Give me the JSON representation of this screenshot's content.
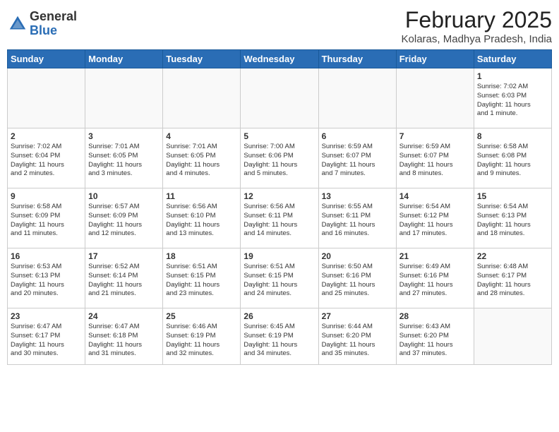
{
  "header": {
    "logo_general": "General",
    "logo_blue": "Blue",
    "month_title": "February 2025",
    "location": "Kolaras, Madhya Pradesh, India"
  },
  "weekdays": [
    "Sunday",
    "Monday",
    "Tuesday",
    "Wednesday",
    "Thursday",
    "Friday",
    "Saturday"
  ],
  "weeks": [
    [
      {
        "day": "",
        "info": ""
      },
      {
        "day": "",
        "info": ""
      },
      {
        "day": "",
        "info": ""
      },
      {
        "day": "",
        "info": ""
      },
      {
        "day": "",
        "info": ""
      },
      {
        "day": "",
        "info": ""
      },
      {
        "day": "1",
        "info": "Sunrise: 7:02 AM\nSunset: 6:03 PM\nDaylight: 11 hours\nand 1 minute."
      }
    ],
    [
      {
        "day": "2",
        "info": "Sunrise: 7:02 AM\nSunset: 6:04 PM\nDaylight: 11 hours\nand 2 minutes."
      },
      {
        "day": "3",
        "info": "Sunrise: 7:01 AM\nSunset: 6:05 PM\nDaylight: 11 hours\nand 3 minutes."
      },
      {
        "day": "4",
        "info": "Sunrise: 7:01 AM\nSunset: 6:05 PM\nDaylight: 11 hours\nand 4 minutes."
      },
      {
        "day": "5",
        "info": "Sunrise: 7:00 AM\nSunset: 6:06 PM\nDaylight: 11 hours\nand 5 minutes."
      },
      {
        "day": "6",
        "info": "Sunrise: 6:59 AM\nSunset: 6:07 PM\nDaylight: 11 hours\nand 7 minutes."
      },
      {
        "day": "7",
        "info": "Sunrise: 6:59 AM\nSunset: 6:07 PM\nDaylight: 11 hours\nand 8 minutes."
      },
      {
        "day": "8",
        "info": "Sunrise: 6:58 AM\nSunset: 6:08 PM\nDaylight: 11 hours\nand 9 minutes."
      }
    ],
    [
      {
        "day": "9",
        "info": "Sunrise: 6:58 AM\nSunset: 6:09 PM\nDaylight: 11 hours\nand 11 minutes."
      },
      {
        "day": "10",
        "info": "Sunrise: 6:57 AM\nSunset: 6:09 PM\nDaylight: 11 hours\nand 12 minutes."
      },
      {
        "day": "11",
        "info": "Sunrise: 6:56 AM\nSunset: 6:10 PM\nDaylight: 11 hours\nand 13 minutes."
      },
      {
        "day": "12",
        "info": "Sunrise: 6:56 AM\nSunset: 6:11 PM\nDaylight: 11 hours\nand 14 minutes."
      },
      {
        "day": "13",
        "info": "Sunrise: 6:55 AM\nSunset: 6:11 PM\nDaylight: 11 hours\nand 16 minutes."
      },
      {
        "day": "14",
        "info": "Sunrise: 6:54 AM\nSunset: 6:12 PM\nDaylight: 11 hours\nand 17 minutes."
      },
      {
        "day": "15",
        "info": "Sunrise: 6:54 AM\nSunset: 6:13 PM\nDaylight: 11 hours\nand 18 minutes."
      }
    ],
    [
      {
        "day": "16",
        "info": "Sunrise: 6:53 AM\nSunset: 6:13 PM\nDaylight: 11 hours\nand 20 minutes."
      },
      {
        "day": "17",
        "info": "Sunrise: 6:52 AM\nSunset: 6:14 PM\nDaylight: 11 hours\nand 21 minutes."
      },
      {
        "day": "18",
        "info": "Sunrise: 6:51 AM\nSunset: 6:15 PM\nDaylight: 11 hours\nand 23 minutes."
      },
      {
        "day": "19",
        "info": "Sunrise: 6:51 AM\nSunset: 6:15 PM\nDaylight: 11 hours\nand 24 minutes."
      },
      {
        "day": "20",
        "info": "Sunrise: 6:50 AM\nSunset: 6:16 PM\nDaylight: 11 hours\nand 25 minutes."
      },
      {
        "day": "21",
        "info": "Sunrise: 6:49 AM\nSunset: 6:16 PM\nDaylight: 11 hours\nand 27 minutes."
      },
      {
        "day": "22",
        "info": "Sunrise: 6:48 AM\nSunset: 6:17 PM\nDaylight: 11 hours\nand 28 minutes."
      }
    ],
    [
      {
        "day": "23",
        "info": "Sunrise: 6:47 AM\nSunset: 6:17 PM\nDaylight: 11 hours\nand 30 minutes."
      },
      {
        "day": "24",
        "info": "Sunrise: 6:47 AM\nSunset: 6:18 PM\nDaylight: 11 hours\nand 31 minutes."
      },
      {
        "day": "25",
        "info": "Sunrise: 6:46 AM\nSunset: 6:19 PM\nDaylight: 11 hours\nand 32 minutes."
      },
      {
        "day": "26",
        "info": "Sunrise: 6:45 AM\nSunset: 6:19 PM\nDaylight: 11 hours\nand 34 minutes."
      },
      {
        "day": "27",
        "info": "Sunrise: 6:44 AM\nSunset: 6:20 PM\nDaylight: 11 hours\nand 35 minutes."
      },
      {
        "day": "28",
        "info": "Sunrise: 6:43 AM\nSunset: 6:20 PM\nDaylight: 11 hours\nand 37 minutes."
      },
      {
        "day": "",
        "info": ""
      }
    ]
  ]
}
